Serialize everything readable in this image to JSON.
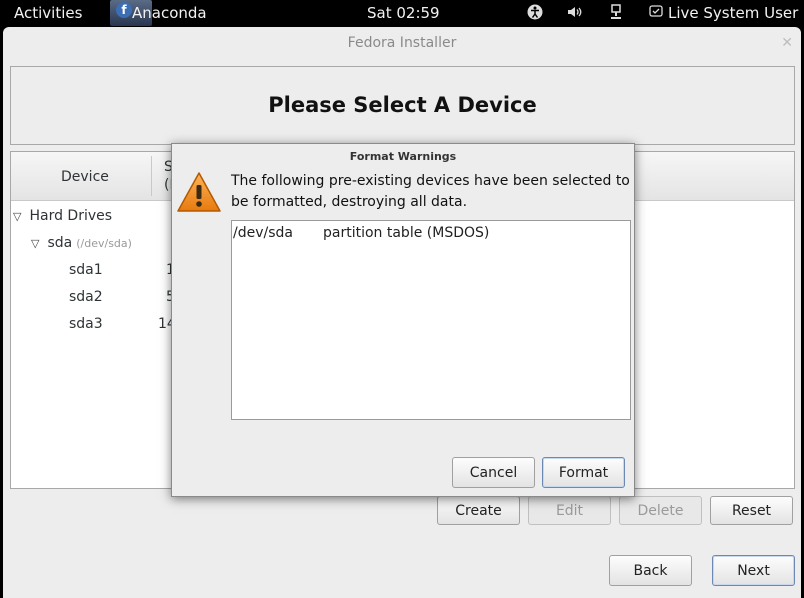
{
  "topbar": {
    "activities": "Activities",
    "app_name": "Anaconda",
    "clock": "Sat 02:59",
    "user": "Live System User",
    "icons": [
      "accessibility-icon",
      "volume-icon",
      "network-icon",
      "user-icon"
    ]
  },
  "window": {
    "title": "Fedora Installer",
    "heading": "Please Select A Device"
  },
  "tree": {
    "col_device": "Device",
    "col_size_line1": "S",
    "col_size_line2": "(I",
    "group": "Hard Drives",
    "disk": {
      "name": "sda",
      "path": "(/dev/sda)"
    },
    "partitions": [
      {
        "name": "sda1",
        "size": "1"
      },
      {
        "name": "sda2",
        "size": "5"
      },
      {
        "name": "sda3",
        "size": "14"
      }
    ]
  },
  "actions": {
    "create": "Create",
    "edit": "Edit",
    "delete": "Delete",
    "reset": "Reset"
  },
  "nav": {
    "back": "Back",
    "next": "Next"
  },
  "dialog": {
    "title": "Format Warnings",
    "message": "The following pre-existing devices have been selected to be formatted, destroying all data.",
    "rows": [
      {
        "device": "/dev/sda",
        "description": "partition table (MSDOS)"
      }
    ],
    "cancel": "Cancel",
    "format": "Format"
  }
}
